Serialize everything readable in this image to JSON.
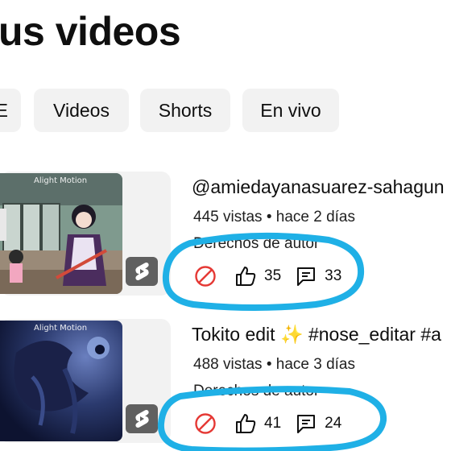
{
  "header": {
    "title": "us videos"
  },
  "chips": [
    "E",
    "Videos",
    "Shorts",
    "En vivo"
  ],
  "thumb_watermark": "Alight Motion",
  "videos": [
    {
      "title": "@amiedayanasuarez-sahagun",
      "meta": "445 vistas • hace 2 días",
      "rights": "Derechos de autor",
      "likes": "35",
      "comments": "33"
    },
    {
      "title": "Tokito edit ✨ #nose_editar #a",
      "meta": "488 vistas • hace 3 días",
      "rights": "Derechos de autor",
      "likes": "41",
      "comments": "24"
    }
  ],
  "colors": {
    "annotation": "#1fb0e6",
    "restricted": "#e53935",
    "chip_bg": "#f2f2f2",
    "text": "#0f0f0f"
  },
  "icons": [
    "restricted-icon",
    "like-icon",
    "comment-icon",
    "shorts-icon"
  ]
}
